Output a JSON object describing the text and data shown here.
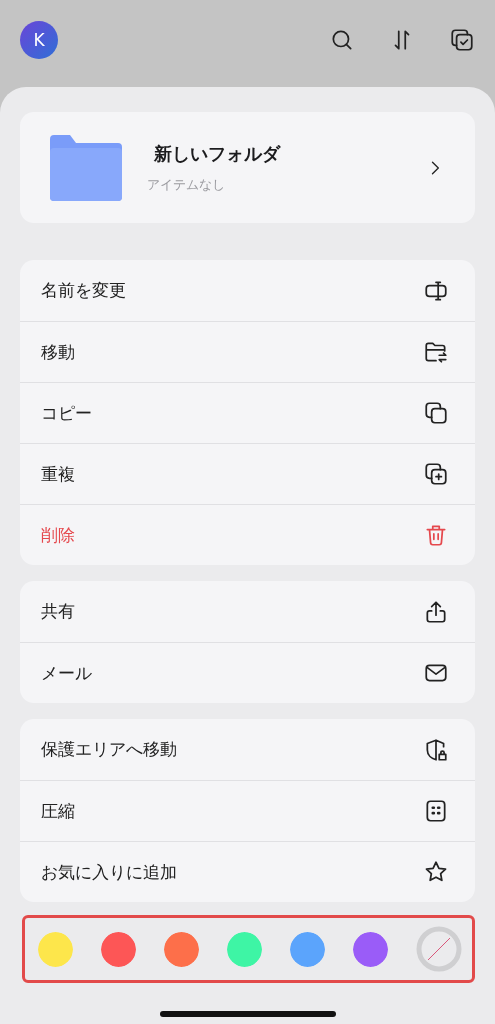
{
  "top_bar": {
    "avatar_letter": "K"
  },
  "folder": {
    "name": "新しいフォルダ",
    "subtitle": "アイテムなし"
  },
  "menu_groups": [
    {
      "items": [
        {
          "label": "名前を変更",
          "destructive": false
        },
        {
          "label": "移動",
          "destructive": false
        },
        {
          "label": "コピー",
          "destructive": false
        },
        {
          "label": "重複",
          "destructive": false
        },
        {
          "label": "削除",
          "destructive": true
        }
      ]
    },
    {
      "items": [
        {
          "label": "共有",
          "destructive": false
        },
        {
          "label": "メール",
          "destructive": false
        }
      ]
    },
    {
      "items": [
        {
          "label": "保護エリアへ移動",
          "destructive": false
        },
        {
          "label": "圧縮",
          "destructive": false
        },
        {
          "label": "お気に入りに追加",
          "destructive": false
        }
      ]
    }
  ],
  "color_tags": [
    {
      "kind": "color",
      "color": "#fde64b"
    },
    {
      "kind": "color",
      "color": "#fd5656"
    },
    {
      "kind": "color",
      "color": "#fd6f4a"
    },
    {
      "kind": "color",
      "color": "#3ef5a5"
    },
    {
      "kind": "color",
      "color": "#5ba4fc"
    },
    {
      "kind": "color",
      "color": "#9a5cf8"
    },
    {
      "kind": "none"
    }
  ]
}
